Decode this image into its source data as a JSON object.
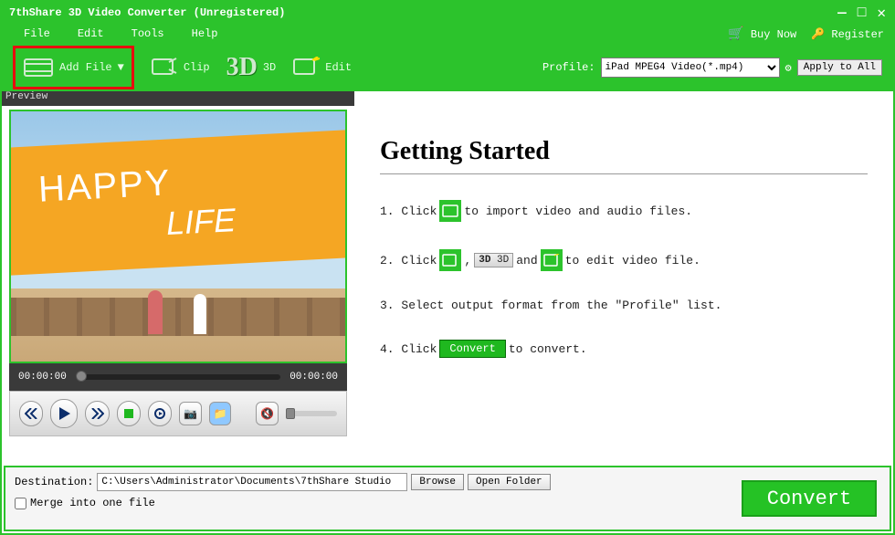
{
  "window": {
    "title": "7thShare 3D Video Converter (Unregistered)"
  },
  "menu": {
    "file": "File",
    "edit": "Edit",
    "tools": "Tools",
    "help": "Help",
    "buynow": "Buy Now",
    "register": "Register"
  },
  "toolbar": {
    "addfile": "Add File",
    "clip": "Clip",
    "threed": "3D",
    "threed_label": "3D",
    "edit": "Edit"
  },
  "profile": {
    "label": "Profile:",
    "selected": "iPad MPEG4 Video(*.mp4)",
    "apply": "Apply to All"
  },
  "preview": {
    "header": "Preview",
    "time_start": "00:00:00",
    "time_end": "00:00:00",
    "happy": "HAPPY",
    "life": "LIFE"
  },
  "guide": {
    "title": "Getting Started",
    "s1a": "1. Click",
    "s1b": "to import video and audio files.",
    "s2a": "2. Click",
    "s2b": ",",
    "s2c": "and",
    "s2d": "to edit video file.",
    "s2_3d": "3D",
    "s3": "3. Select output format from the \"Profile\" list.",
    "s4a": "4. Click",
    "s4b": "to convert.",
    "s4_convert": "Convert"
  },
  "dest": {
    "label": "Destination:",
    "path": "C:\\Users\\Administrator\\Documents\\7thShare Studio",
    "browse": "Browse",
    "open": "Open Folder",
    "merge": "Merge into one file",
    "convert": "Convert"
  }
}
